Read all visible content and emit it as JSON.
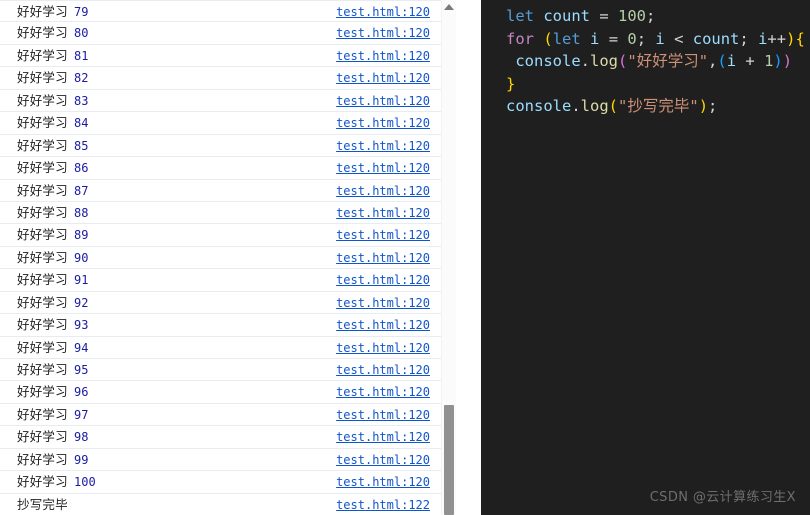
{
  "console": {
    "rows": [
      {
        "message": "好好学习",
        "count": "79",
        "source": "test.html:120"
      },
      {
        "message": "好好学习",
        "count": "80",
        "source": "test.html:120"
      },
      {
        "message": "好好学习",
        "count": "81",
        "source": "test.html:120"
      },
      {
        "message": "好好学习",
        "count": "82",
        "source": "test.html:120"
      },
      {
        "message": "好好学习",
        "count": "83",
        "source": "test.html:120"
      },
      {
        "message": "好好学习",
        "count": "84",
        "source": "test.html:120"
      },
      {
        "message": "好好学习",
        "count": "85",
        "source": "test.html:120"
      },
      {
        "message": "好好学习",
        "count": "86",
        "source": "test.html:120"
      },
      {
        "message": "好好学习",
        "count": "87",
        "source": "test.html:120"
      },
      {
        "message": "好好学习",
        "count": "88",
        "source": "test.html:120"
      },
      {
        "message": "好好学习",
        "count": "89",
        "source": "test.html:120"
      },
      {
        "message": "好好学习",
        "count": "90",
        "source": "test.html:120"
      },
      {
        "message": "好好学习",
        "count": "91",
        "source": "test.html:120"
      },
      {
        "message": "好好学习",
        "count": "92",
        "source": "test.html:120"
      },
      {
        "message": "好好学习",
        "count": "93",
        "source": "test.html:120"
      },
      {
        "message": "好好学习",
        "count": "94",
        "source": "test.html:120"
      },
      {
        "message": "好好学习",
        "count": "95",
        "source": "test.html:120"
      },
      {
        "message": "好好学习",
        "count": "96",
        "source": "test.html:120"
      },
      {
        "message": "好好学习",
        "count": "97",
        "source": "test.html:120"
      },
      {
        "message": "好好学习",
        "count": "98",
        "source": "test.html:120"
      },
      {
        "message": "好好学习",
        "count": "99",
        "source": "test.html:120"
      },
      {
        "message": "好好学习",
        "count": "100",
        "source": "test.html:120"
      },
      {
        "message": "抄写完毕",
        "count": "",
        "source": "test.html:122"
      }
    ],
    "scrollbar": {
      "up_arrow_icon": "triangle-up-icon"
    },
    "colors": {
      "message_text": "#222222",
      "count_number": "#1a1aa6",
      "source_link": "#1155cc",
      "row_divider": "#e6ecf2"
    }
  },
  "code": {
    "background": "#1f1f1f",
    "lines": [
      {
        "id": "line-1",
        "tokens": [
          {
            "text": "let",
            "cls": "tk-kw-let"
          },
          {
            "text": " ",
            "cls": "tk-op"
          },
          {
            "text": "count",
            "cls": "tk-var"
          },
          {
            "text": " = ",
            "cls": "tk-op"
          },
          {
            "text": "100",
            "cls": "tk-num"
          },
          {
            "text": ";",
            "cls": "tk-punct"
          }
        ]
      },
      {
        "id": "line-2",
        "tokens": [
          {
            "text": "for",
            "cls": "tk-kw-for"
          },
          {
            "text": " ",
            "cls": "tk-op"
          },
          {
            "text": "(",
            "cls": "tk-paren-y"
          },
          {
            "text": "let",
            "cls": "tk-kw-let"
          },
          {
            "text": " ",
            "cls": "tk-op"
          },
          {
            "text": "i",
            "cls": "tk-var"
          },
          {
            "text": " = ",
            "cls": "tk-op"
          },
          {
            "text": "0",
            "cls": "tk-num"
          },
          {
            "text": "; ",
            "cls": "tk-punct"
          },
          {
            "text": "i",
            "cls": "tk-var"
          },
          {
            "text": " < ",
            "cls": "tk-op"
          },
          {
            "text": "count",
            "cls": "tk-var"
          },
          {
            "text": "; ",
            "cls": "tk-punct"
          },
          {
            "text": "i",
            "cls": "tk-var"
          },
          {
            "text": "++",
            "cls": "tk-op"
          },
          {
            "text": ")",
            "cls": "tk-paren-y"
          },
          {
            "text": "{",
            "cls": "tk-brace-y"
          }
        ]
      },
      {
        "id": "line-3",
        "tokens": [
          {
            "text": " ",
            "cls": "tk-op"
          },
          {
            "text": "console",
            "cls": "tk-var"
          },
          {
            "text": ".",
            "cls": "tk-punct"
          },
          {
            "text": "log",
            "cls": "tk-fn"
          },
          {
            "text": "(",
            "cls": "tk-paren-m"
          },
          {
            "text": "\"好好学习\"",
            "cls": "tk-str"
          },
          {
            "text": ",",
            "cls": "tk-punct"
          },
          {
            "text": "(",
            "cls": "tk-paren-b"
          },
          {
            "text": "i",
            "cls": "tk-var"
          },
          {
            "text": " + ",
            "cls": "tk-op"
          },
          {
            "text": "1",
            "cls": "tk-num"
          },
          {
            "text": ")",
            "cls": "tk-paren-b"
          },
          {
            "text": ")",
            "cls": "tk-paren-m"
          }
        ]
      },
      {
        "id": "line-4",
        "tokens": [
          {
            "text": "}",
            "cls": "tk-brace-y"
          }
        ]
      },
      {
        "id": "line-5",
        "tokens": [
          {
            "text": "console",
            "cls": "tk-var"
          },
          {
            "text": ".",
            "cls": "tk-punct"
          },
          {
            "text": "log",
            "cls": "tk-fn"
          },
          {
            "text": "(",
            "cls": "tk-paren-y"
          },
          {
            "text": "\"抄写完毕\"",
            "cls": "tk-str"
          },
          {
            "text": ")",
            "cls": "tk-paren-y"
          },
          {
            "text": ";",
            "cls": "tk-punct"
          }
        ]
      }
    ]
  },
  "watermark": {
    "text": "CSDN @云计算练习生X"
  }
}
